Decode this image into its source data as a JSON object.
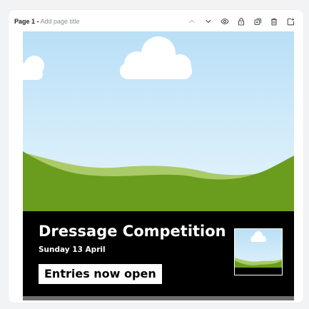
{
  "page_header": {
    "page_label": "Page 1 -",
    "title_placeholder": "Add page title",
    "toolbar": [
      {
        "icon": "chevron-up-icon",
        "name": "move-page-up-button"
      },
      {
        "icon": "chevron-down-icon",
        "name": "move-page-down-button"
      },
      {
        "icon": "eye-icon",
        "name": "hide-page-button"
      },
      {
        "icon": "lock-icon",
        "name": "lock-page-button"
      },
      {
        "icon": "duplicate-icon",
        "name": "duplicate-page-button"
      },
      {
        "icon": "trash-icon",
        "name": "delete-page-button"
      },
      {
        "icon": "add-page-icon",
        "name": "add-page-button"
      }
    ]
  },
  "design": {
    "headline": "Dressage Competition",
    "date": "Sunday 13 April",
    "cta": "Entries now open",
    "colors": {
      "banner_background": "#000000",
      "sky_top": "#b9dff6",
      "sky_bottom": "#e6f5fc",
      "hill_light": "#aacb67",
      "hill_dark": "#6a9d1e",
      "cloud": "#ffffff",
      "text": "#ffffff"
    }
  }
}
